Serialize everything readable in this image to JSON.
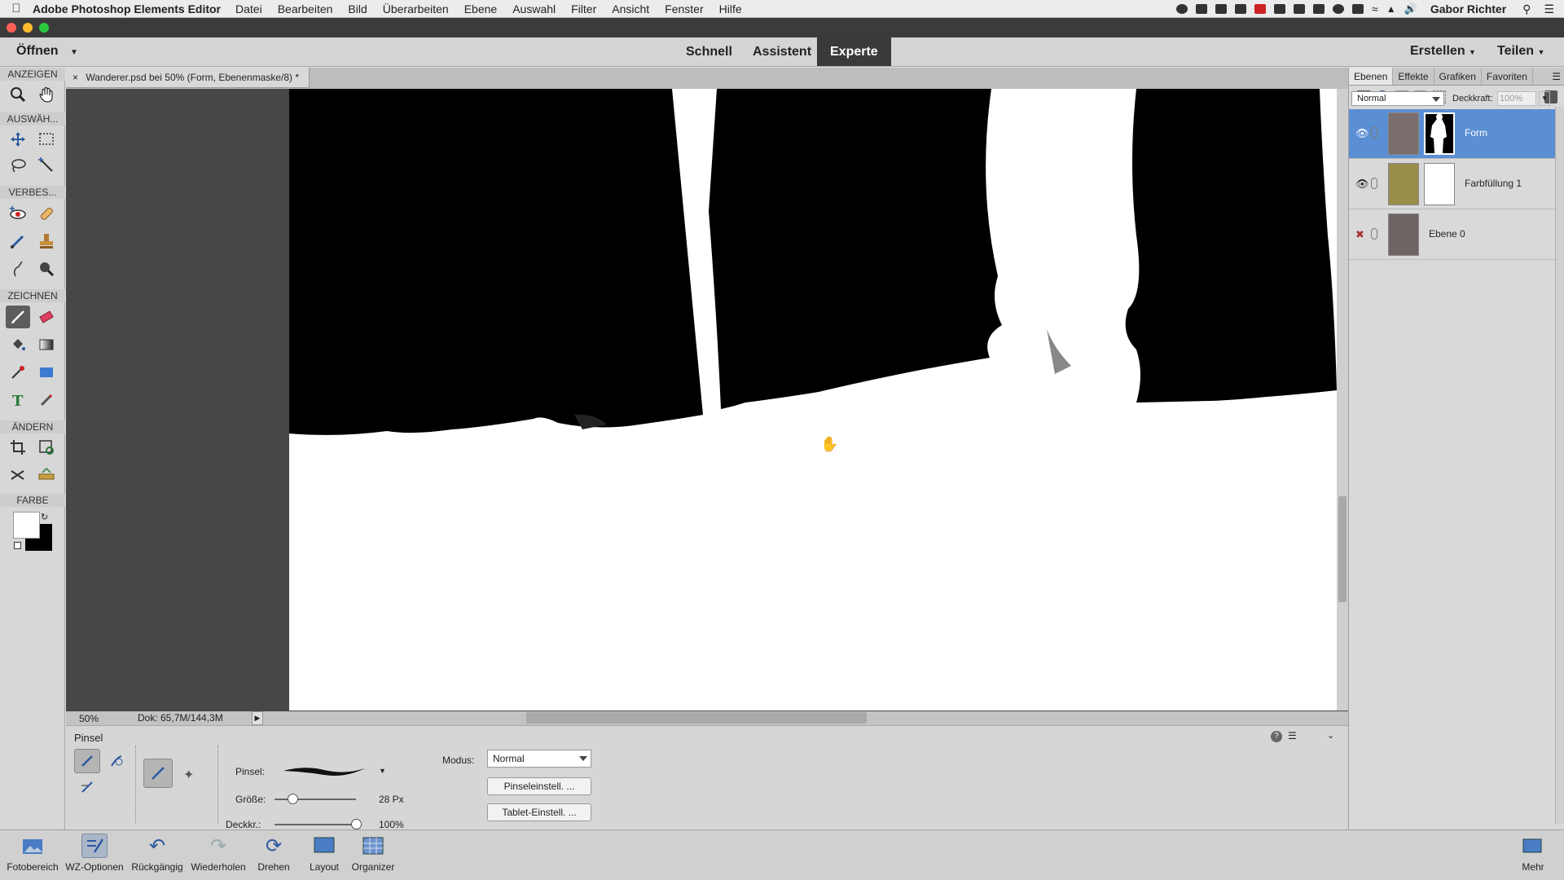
{
  "menubar": {
    "app_name": "Adobe Photoshop Elements Editor",
    "menus": [
      "Datei",
      "Bearbeiten",
      "Bild",
      "Überarbeiten",
      "Ebene",
      "Auswahl",
      "Filter",
      "Ansicht",
      "Fenster",
      "Hilfe"
    ],
    "user": "Gabor Richter"
  },
  "modebar": {
    "open_label": "Öffnen",
    "modes": [
      "Schnell",
      "Assistent",
      "Experte"
    ],
    "active_mode": "Experte",
    "create_label": "Erstellen",
    "share_label": "Teilen"
  },
  "toolbox": {
    "sections": [
      "ANZEIGEN",
      "AUSWÄH...",
      "VERBES...",
      "ZEICHNEN",
      "ÄNDERN",
      "FARBE"
    ]
  },
  "document": {
    "tab_title": "Wanderer.psd bei 50% (Form, Ebenenmaske/8) *",
    "zoom": "50%",
    "doc_info": "Dok: 65,7M/144,3M"
  },
  "tool_options": {
    "title": "Pinsel",
    "brush_label": "Pinsel:",
    "size_label": "Größe:",
    "size_value": "28 Px",
    "size_fraction": 0.22,
    "opacity_label": "Deckkr.:",
    "opacity_value": "100%",
    "opacity_fraction": 1.0,
    "mode_label": "Modus:",
    "mode_value": "Normal",
    "brush_settings_button": "Pinseleinstell. ...",
    "tablet_settings_button": "Tablet-Einstell. ..."
  },
  "panel": {
    "tabs": [
      "Ebenen",
      "Effekte",
      "Grafiken",
      "Favoriten"
    ],
    "active_tab": "Ebenen",
    "blend_mode": "Normal",
    "opacity_label": "Deckkraft:",
    "opacity_value": "100%",
    "layers": [
      {
        "name": "Form",
        "visible": true,
        "selected": true
      },
      {
        "name": "Farbfüllung 1",
        "visible": true,
        "selected": false
      },
      {
        "name": "Ebene 0",
        "visible": false,
        "selected": false
      }
    ],
    "fill_color": "#9a8d4a"
  },
  "taskbar": {
    "items": [
      "Fotobereich",
      "WZ-Optionen",
      "Rückgängig",
      "Wiederholen",
      "Drehen",
      "Layout",
      "Organizer"
    ],
    "more_label": "Mehr"
  },
  "colors": {
    "accent": "#5b8fd3",
    "foreground": "#ffffff",
    "background": "#000000"
  }
}
